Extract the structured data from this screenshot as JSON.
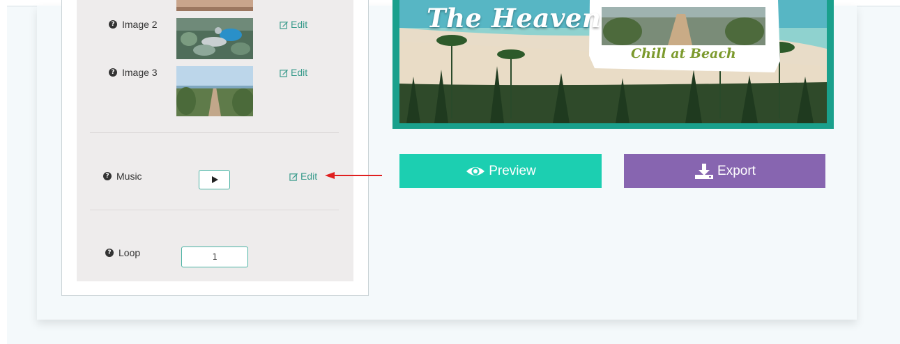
{
  "images": [
    {
      "label": "Image 2",
      "edit_label": "Edit"
    },
    {
      "label": "Image 3",
      "edit_label": "Edit"
    }
  ],
  "music": {
    "label": "Music",
    "edit_label": "Edit"
  },
  "loop": {
    "label": "Loop",
    "value": "1"
  },
  "preview_image": {
    "title_text": "The Heaven",
    "caption_text": "Chill at Beach"
  },
  "actions": {
    "preview_label": "Preview",
    "export_label": "Export"
  },
  "colors": {
    "accent_teal": "#1ccfb1",
    "export_purple": "#8765b0",
    "edit_link": "#3a9b8c",
    "annotation_arrow": "#e02020"
  },
  "icons": {
    "help": "question-circle-icon",
    "edit": "pencil-square-icon",
    "play": "play-icon",
    "preview": "eye-icon",
    "export": "download-icon"
  }
}
